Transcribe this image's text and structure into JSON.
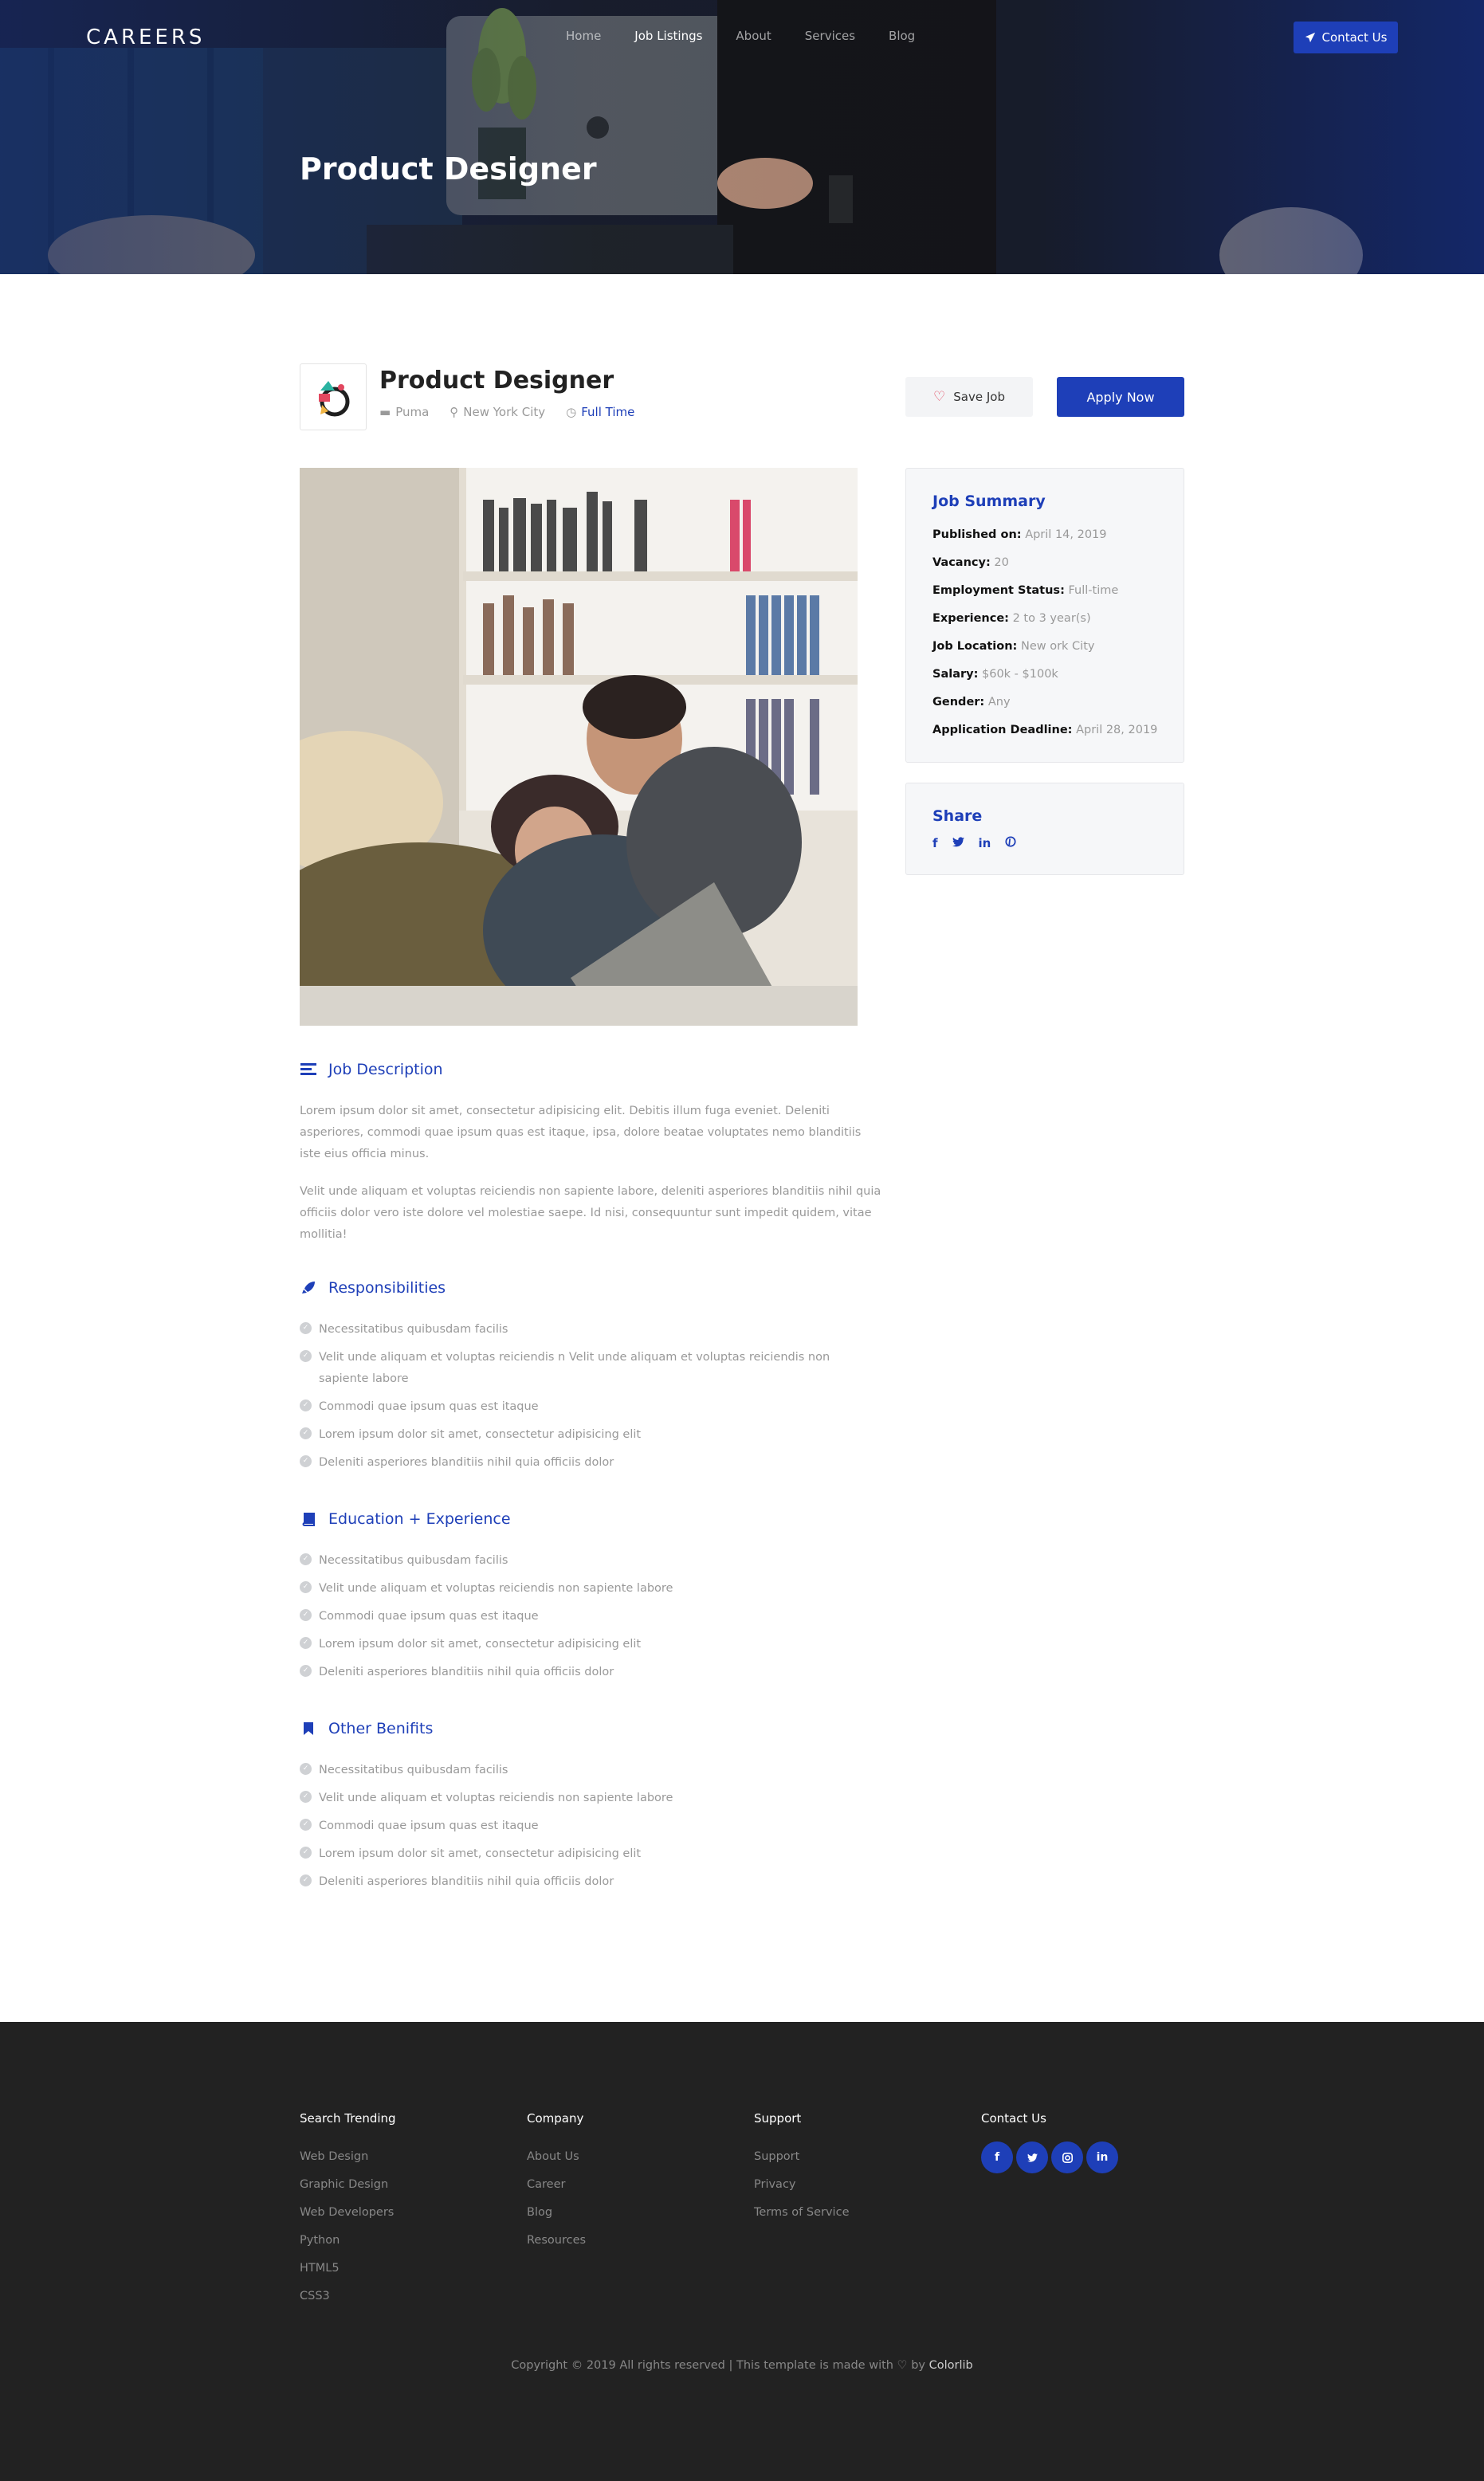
{
  "nav": {
    "brand": "CAREERS",
    "links": [
      "Home",
      "Job Listings",
      "About",
      "Services",
      "Blog"
    ],
    "contact_label": "Contact Us"
  },
  "hero": {
    "title": "Product Designer"
  },
  "job": {
    "title": "Product Designer",
    "company": "Puma",
    "location": "New York City",
    "type": "Full Time",
    "save_label": "Save Job",
    "apply_label": "Apply Now"
  },
  "summary": {
    "title": "Job Summary",
    "rows": [
      {
        "label": "Published on:",
        "value": "April 14, 2019"
      },
      {
        "label": "Vacancy:",
        "value": "20"
      },
      {
        "label": "Employment Status:",
        "value": "Full-time"
      },
      {
        "label": "Experience:",
        "value": "2 to 3 year(s)"
      },
      {
        "label": "Job Location:",
        "value": "New ork City"
      },
      {
        "label": "Salary:",
        "value": "$60k - $100k"
      },
      {
        "label": "Gender:",
        "value": "Any"
      },
      {
        "label": "Application Deadline:",
        "value": "April 28, 2019"
      }
    ]
  },
  "share": {
    "title": "Share",
    "icons": [
      "facebook-icon",
      "twitter-icon",
      "linkedin-icon",
      "pinterest-icon"
    ]
  },
  "description": {
    "title": "Job Description",
    "paragraphs": [
      "Lorem ipsum dolor sit amet, consectetur adipisicing elit. Debitis illum fuga eveniet. Deleniti asperiores, commodi quae ipsum quas est itaque, ipsa, dolore beatae voluptates nemo blanditiis iste eius officia minus.",
      "Velit unde aliquam et voluptas reiciendis non sapiente labore, deleniti asperiores blanditiis nihil quia officiis dolor vero iste dolore vel molestiae saepe. Id nisi, consequuntur sunt impedit quidem, vitae mollitia!"
    ]
  },
  "responsibilities": {
    "title": "Responsibilities",
    "items": [
      "Necessitatibus quibusdam facilis",
      "Velit unde aliquam et voluptas reiciendis n Velit unde aliquam et voluptas reiciendis non sapiente labore",
      "Commodi quae ipsum quas est itaque",
      "Lorem ipsum dolor sit amet, consectetur adipisicing elit",
      "Deleniti asperiores blanditiis nihil quia officiis dolor"
    ]
  },
  "education": {
    "title": "Education + Experience",
    "items": [
      "Necessitatibus quibusdam facilis",
      "Velit unde aliquam et voluptas reiciendis non sapiente labore",
      "Commodi quae ipsum quas est itaque",
      "Lorem ipsum dolor sit amet, consectetur adipisicing elit",
      "Deleniti asperiores blanditiis nihil quia officiis dolor"
    ]
  },
  "benefits": {
    "title": "Other Benifits",
    "items": [
      "Necessitatibus quibusdam facilis",
      "Velit unde aliquam et voluptas reiciendis non sapiente labore",
      "Commodi quae ipsum quas est itaque",
      "Lorem ipsum dolor sit amet, consectetur adipisicing elit",
      "Deleniti asperiores blanditiis nihil quia officiis dolor"
    ]
  },
  "footer": {
    "trending": {
      "title": "Search Trending",
      "links": [
        "Web Design",
        "Graphic Design",
        "Web Developers",
        "Python",
        "HTML5",
        "CSS3"
      ]
    },
    "company": {
      "title": "Company",
      "links": [
        "About Us",
        "Career",
        "Blog",
        "Resources"
      ]
    },
    "support": {
      "title": "Support",
      "links": [
        "Support",
        "Privacy",
        "Terms of Service"
      ]
    },
    "contact": {
      "title": "Contact Us",
      "icons": [
        "facebook-icon",
        "twitter-icon",
        "instagram-icon",
        "linkedin-icon"
      ]
    },
    "copyright_text": "Copyright © 2019 All rights reserved | This template is made with",
    "copyright_by": "by",
    "copyright_brand": "Colorlib"
  },
  "colors": {
    "accent": "#1e3fb8",
    "footer_bg": "#222222"
  }
}
